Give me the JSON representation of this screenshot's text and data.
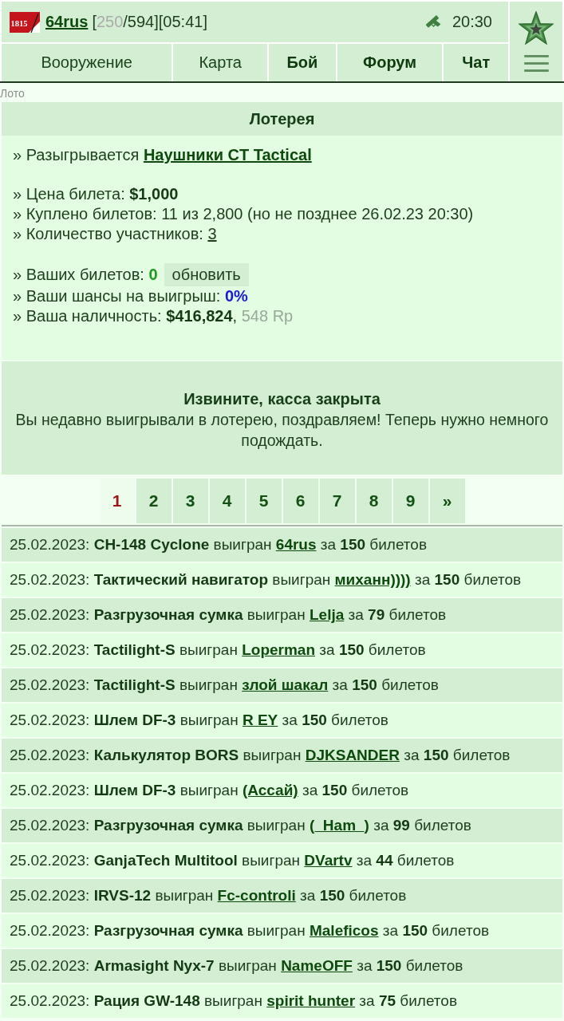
{
  "header": {
    "emblem_text": "1815",
    "username": "64rus",
    "status_parts": [
      {
        "kind": "text",
        "text": "["
      },
      {
        "kind": "muted",
        "text": "250"
      },
      {
        "kind": "text",
        "text": "/594][05:41]"
      }
    ],
    "time": "20:30"
  },
  "nav_tabs": [
    {
      "label": "Вооружение",
      "highlighted": false
    },
    {
      "label": "Карта",
      "highlighted": false
    },
    {
      "label": "Бой",
      "highlighted": true
    },
    {
      "label": "Форум",
      "highlighted": true
    },
    {
      "label": "Чат",
      "highlighted": true
    }
  ],
  "breadcrumb": "Лото",
  "lottery": {
    "title": "Лотерея",
    "info_groups": [
      {
        "lines": [
          {
            "parts": [
              {
                "kind": "text",
                "text": "» Разыгрывается"
              },
              {
                "kind": "prize_link",
                "text": "Наушники CT Tactical"
              }
            ]
          }
        ]
      },
      {
        "lines": [
          {
            "parts": [
              {
                "kind": "text",
                "text": "» Цена билета: **$1,000**"
              }
            ]
          },
          {
            "parts": [
              {
                "kind": "text",
                "text": "» Куплено билетов: 11 из 2,800 (но не позднее 26.02.23 20:30)"
              }
            ]
          },
          {
            "parts": [
              {
                "kind": "text",
                "text": "» Количество участников:"
              },
              {
                "kind": "link",
                "text": "3"
              }
            ]
          }
        ]
      },
      {
        "lines": [
          {
            "parts": [
              {
                "kind": "text",
                "text": "» Ваших билетов:"
              },
              {
                "kind": "good",
                "text": "0"
              },
              {
                "kind": "button",
                "text": "обновить"
              }
            ]
          },
          {
            "parts": [
              {
                "kind": "text",
                "text": "» Ваши шансы на выигрыш:"
              },
              {
                "kind": "chance",
                "text": "0%"
              }
            ]
          },
          {
            "parts": [
              {
                "kind": "text",
                "text": "» Ваша наличность: **$416,824**,"
              },
              {
                "kind": "muted",
                "text": "548 Rp"
              }
            ]
          }
        ]
      }
    ],
    "notice": {
      "title": "Извините, касса закрыта",
      "text": "Вы недавно выигрывали в лотерею, поздравляем! Теперь нужно немного подождать."
    }
  },
  "pages": [
    {
      "label": "1",
      "selected": true
    },
    {
      "label": "2",
      "selected": false
    },
    {
      "label": "3",
      "selected": false
    },
    {
      "label": "4",
      "selected": false
    },
    {
      "label": "5",
      "selected": false
    },
    {
      "label": "6",
      "selected": false
    },
    {
      "label": "7",
      "selected": false
    },
    {
      "label": "8",
      "selected": false
    },
    {
      "label": "9",
      "selected": false
    },
    {
      "label": "»",
      "selected": false
    }
  ],
  "history": [
    {
      "prize_text": "25.02.2023: **CH-148 Cyclone** выигран",
      "winner": "64rus",
      "tickets_text": "за **150** билетов"
    },
    {
      "prize_text": "25.02.2023: **Тактический навигатор** выигран",
      "winner": "миханн))))",
      "tickets_text": "за **150** билетов"
    },
    {
      "prize_text": "25.02.2023: **Разгрузочная сумка** выигран",
      "winner": "Lelja",
      "tickets_text": "за **79** билетов"
    },
    {
      "prize_text": "25.02.2023: **Tactilight-S** выигран",
      "winner": "Loperman",
      "tickets_text": "за **150** билетов"
    },
    {
      "prize_text": "25.02.2023: **Tactilight-S** выигран",
      "winner": "злой шакал",
      "tickets_text": "за **150** билетов"
    },
    {
      "prize_text": "25.02.2023: **Шлем DF-3** выигран",
      "winner": "R EY",
      "tickets_text": "за **150** билетов"
    },
    {
      "prize_text": "25.02.2023: **Калькулятор BORS** выигран",
      "winner": "DJKSANDER",
      "tickets_text": "за **150** билетов"
    },
    {
      "prize_text": "25.02.2023: **Шлем DF-3** выигран",
      "winner": "(Ассай)",
      "tickets_text": "за **150** билетов"
    },
    {
      "prize_text": "25.02.2023: **Разгрузочная сумка** выигран",
      "winner": "(_Ham_)",
      "tickets_text": "за **99** билетов"
    },
    {
      "prize_text": "25.02.2023: **GanjaTech Multitool** выигран",
      "winner": "DVartv",
      "tickets_text": "за **44** билетов"
    },
    {
      "prize_text": "25.02.2023: **IRVS-12** выигран",
      "winner": "Fc-controli",
      "tickets_text": "за **150** билетов"
    },
    {
      "prize_text": "25.02.2023: **Разгрузочная сумка** выигран",
      "winner": "Maleficos",
      "tickets_text": "за **150** билетов"
    },
    {
      "prize_text": "25.02.2023: **Armasight Nyx-7** выигран",
      "winner": "NameOFF",
      "tickets_text": "за **150** билетов"
    },
    {
      "prize_text": "25.02.2023: **Рация GW-148** выигран",
      "winner": "spirit hunter",
      "tickets_text": "за **75** билетов"
    }
  ]
}
